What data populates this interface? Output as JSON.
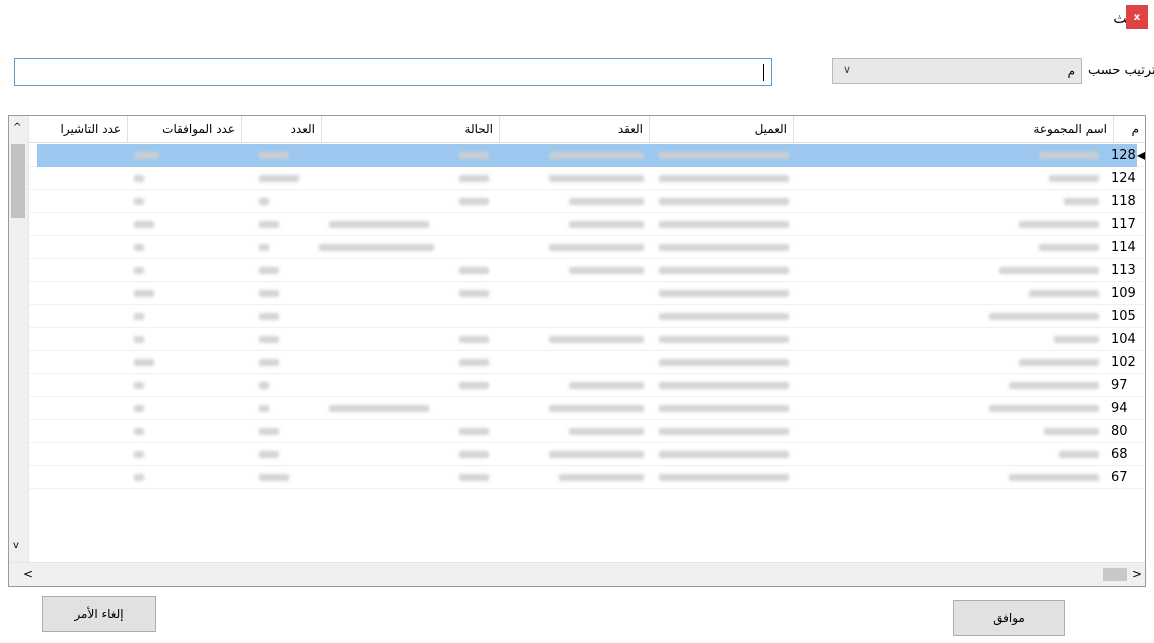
{
  "window": {
    "title": "بحث",
    "close_label": "x"
  },
  "search": {
    "value": "",
    "placeholder": ""
  },
  "sort": {
    "label": "ترتيب حسب",
    "selected": "م"
  },
  "grid": {
    "columns": [
      "م",
      "اسم المجموعة",
      "العميل",
      "العقد",
      "الحالة",
      "العدد",
      "عدد الموافقات",
      "عدد التاشيرا"
    ],
    "selected_row_number": "128",
    "row_numbers": [
      "128",
      "124",
      "118",
      "117",
      "114",
      "113",
      "109",
      "105",
      "104",
      "102",
      "97",
      "94",
      "80",
      "68",
      "67"
    ]
  },
  "buttons": {
    "ok": "موافق",
    "cancel": "إلغاء الأمر"
  },
  "scroll": {
    "up": "^",
    "down": "v",
    "left": "<",
    "right": ">"
  },
  "colors": {
    "selection": "#9cc8ef",
    "close": "#e04343",
    "focus_border": "#5f9ac9"
  }
}
